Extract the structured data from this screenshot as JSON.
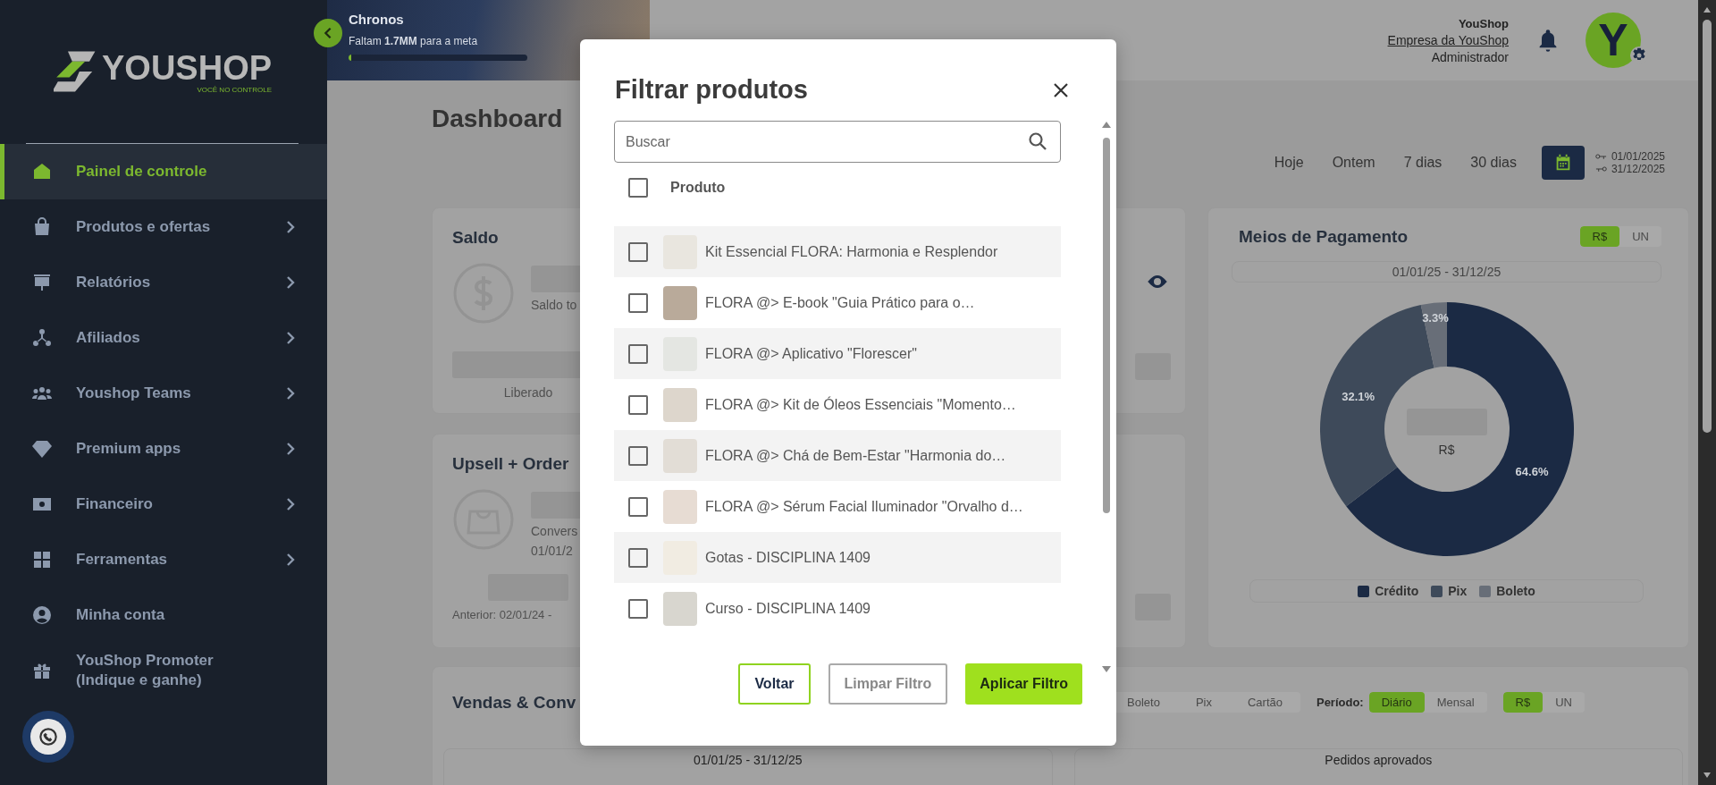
{
  "sidebar": {
    "logo": {
      "wordmark": "YOUSHOP",
      "tagline": "VOCÊ NO CONTROLE"
    },
    "items": [
      {
        "label": "Painel de controle",
        "selected": true,
        "has_submenu": false
      },
      {
        "label": "Produtos e ofertas",
        "selected": false,
        "has_submenu": true
      },
      {
        "label": "Relatórios",
        "selected": false,
        "has_submenu": true
      },
      {
        "label": "Afiliados",
        "selected": false,
        "has_submenu": true
      },
      {
        "label": "Youshop Teams",
        "selected": false,
        "has_submenu": true
      },
      {
        "label": "Premium apps",
        "selected": false,
        "has_submenu": true
      },
      {
        "label": "Financeiro",
        "selected": false,
        "has_submenu": true
      },
      {
        "label": "Ferramentas",
        "selected": false,
        "has_submenu": true
      },
      {
        "label": "Minha conta",
        "selected": false,
        "has_submenu": false
      },
      {
        "label": "YouShop Promoter (Indique e ganhe)",
        "selected": false,
        "has_submenu": false
      }
    ]
  },
  "banner": {
    "title": "Chronos",
    "subtitle": "Faltam **1.7MM** para a meta",
    "level": 0
  },
  "user": {
    "name": "YouShop",
    "company": "Empresa da YouShop",
    "role": "Administrador",
    "avatar_initial": "Y"
  },
  "page_title": "Dashboard",
  "period_filters": [
    {
      "label": "Hoje",
      "selected": false
    },
    {
      "label": "Ontem",
      "selected": false
    },
    {
      "label": "7 dias",
      "selected": false
    },
    {
      "label": "30 dias",
      "selected": false
    }
  ],
  "date_range": {
    "start": "01/01/2025",
    "end": "31/12/2025"
  },
  "saldo_card": {
    "title": "Saldo",
    "total_label": "Saldo to",
    "released_label": "Liberado"
  },
  "upsell_card": {
    "title": "Upsell + Order",
    "conversion_label": "Convers",
    "date_label": "01/01/2",
    "previous_label": "Anterior: 02/01/24 -"
  },
  "payment_card": {
    "title": "Meios de Pagamento",
    "unit_toggle": [
      {
        "label": "R$",
        "selected": true
      },
      {
        "label": "UN",
        "selected": false
      }
    ],
    "date_range": "01/01/25 - 31/12/25",
    "center_label": "R$",
    "chart_data": {
      "type": "donut",
      "categories": [
        "Crédito",
        "Pix",
        "Boleto"
      ],
      "values": [
        64.6,
        32.1,
        3.3
      ],
      "data_labels": "value_labels",
      "value_labels": [
        "64.6%",
        "32.1%",
        "3.3%"
      ]
    },
    "legend": [
      {
        "color": "#1b2a44"
      },
      {
        "color": "#3e4a5a"
      },
      {
        "color": "#686e78"
      }
    ]
  },
  "sales_card": {
    "title": "Vendas & Conv",
    "method_filters": [
      {
        "label": "Boleto",
        "selected": false
      },
      {
        "label": "Pix",
        "selected": false
      },
      {
        "label": "Cartão",
        "selected": false
      }
    ],
    "period_label": "Período:",
    "period_toggle": [
      {
        "label": "Diário",
        "selected": true
      },
      {
        "label": "Mensal",
        "selected": false
      }
    ],
    "unit_toggle": [
      {
        "label": "R$",
        "selected": true
      },
      {
        "label": "UN",
        "selected": false
      }
    ],
    "date_range": "01/01/25 - 31/12/25",
    "orders_title": "Pedidos aprovados"
  },
  "modal": {
    "title": "Filtrar produtos",
    "search": {
      "placeholder": "Buscar"
    },
    "header": {
      "label": "Produto",
      "checked": false
    },
    "products": [
      {
        "name": "Kit Essencial FLORA: Harmonia e Resplendor",
        "checked": false
      },
      {
        "name": "FLORA @> E-book \"Guia Prático para o…",
        "checked": false
      },
      {
        "name": "FLORA @> Aplicativo \"Florescer\"",
        "checked": false
      },
      {
        "name": "FLORA @> Kit de Óleos Essenciais \"Momento…",
        "checked": false
      },
      {
        "name": "FLORA @> Chá de Bem-Estar \"Harmonia do…",
        "checked": false
      },
      {
        "name": "FLORA @> Sérum Facial Iluminador \"Orvalho d…",
        "checked": false
      },
      {
        "name": "Gotas - DISCIPLINA 1409",
        "checked": false
      },
      {
        "name": "Curso - DISCIPLINA 1409",
        "checked": false
      }
    ],
    "buttons": [
      {
        "label": "Voltar",
        "kind": "outline"
      },
      {
        "label": "Limpar Filtro",
        "kind": "secondary"
      },
      {
        "label": "Aplicar Filtro",
        "kind": "primary"
      }
    ]
  }
}
